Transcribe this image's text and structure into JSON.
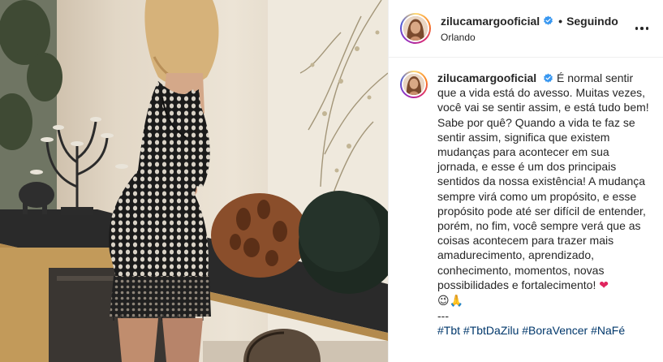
{
  "header": {
    "username": "zilucamargooficial",
    "separator": "•",
    "follow_label": "Seguindo",
    "location": "Orlando",
    "verified_icon": "verified-badge-icon",
    "more_icon": "more-options-icon"
  },
  "caption": {
    "username": "zilucamargooficial",
    "text": "É normal sentir que a vida está do avesso. Muitas vezes, você vai se sentir assim, e está tudo bem! Sabe por quê? Quando a vida te faz se sentir assim, significa que existem mudanças para acontecer em sua jornada, e esse é um dos principais sentidos da nossa existência! A mudança sempre virá como um propósito, e esse propósito pode até ser difícil de entender, porém, no fim, você sempre verá que as coisas acontecem para trazer mais amadurecimento, aprendizado, conhecimento, momentos, novas possibilidades e fortalecimento!",
    "emoji_heart": "❤",
    "emoji_line": "😉🙏",
    "divider": "---",
    "hashtags": [
      "#Tbt",
      "#TbtDaZilu",
      "#BoraVencer",
      "#NaFé"
    ]
  },
  "colors": {
    "verified": "#3897f0",
    "hashtag": "#00376b",
    "heart": "#e0245e",
    "text": "#262626"
  }
}
